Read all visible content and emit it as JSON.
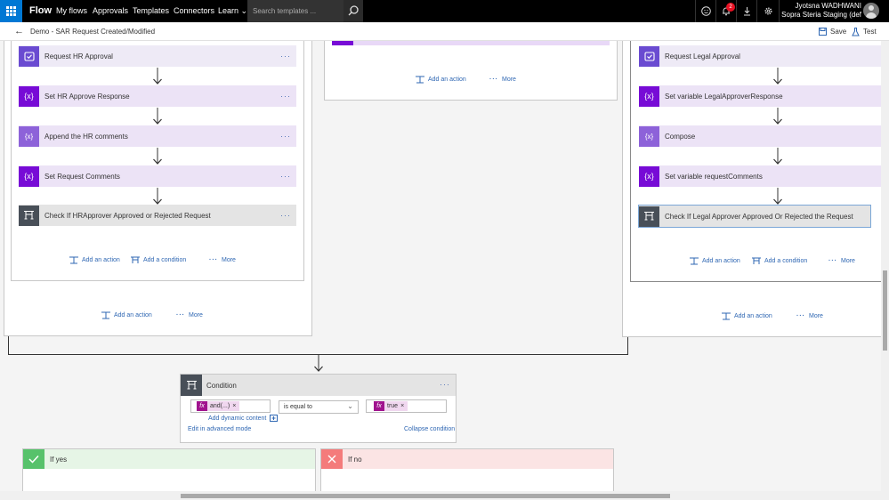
{
  "topbar": {
    "brand": "Flow",
    "nav": [
      "My flows",
      "Approvals",
      "Templates",
      "Connectors",
      "Learn"
    ],
    "search_placeholder": "Search templates ...",
    "notification_count": "2",
    "user_name": "Jyotsna WADHWANI",
    "user_org": "Sopra Steria Staging (def"
  },
  "subbar": {
    "flow_name": "Demo - SAR Request Created/Modified",
    "save_label": "Save",
    "test_label": "Test"
  },
  "left_panel": {
    "steps": [
      {
        "label": "Request HR Approval",
        "icon": "approval-icon"
      },
      {
        "label": "Set HR Approve Response",
        "icon": "variable-icon"
      },
      {
        "label": "Append the HR comments",
        "icon": "variable-icon"
      },
      {
        "label": "Set Request Comments",
        "icon": "variable-icon"
      },
      {
        "label": "Check If HRApprover Approved or Rejected Request",
        "icon": "condition-icon"
      }
    ],
    "inner_add_action": "Add an action",
    "inner_add_condition": "Add a condition",
    "inner_more": "More",
    "outer_add_action": "Add an action",
    "outer_more": "More"
  },
  "middle_panel": {
    "add_action": "Add an action",
    "more": "More"
  },
  "right_panel": {
    "steps": [
      {
        "label": "Request Legal Approval",
        "icon": "approval-icon"
      },
      {
        "label": "Set variable LegalApproverResponse",
        "icon": "variable-icon"
      },
      {
        "label": "Compose",
        "icon": "variable-icon"
      },
      {
        "label": "Set variable requestComments",
        "icon": "variable-icon"
      },
      {
        "label": "Check If Legal Approver Approved Or Rejected the Request",
        "icon": "condition-icon"
      }
    ],
    "inner_add_action": "Add an action",
    "inner_add_condition": "Add a condition",
    "inner_more": "More",
    "outer_add_action": "Add an action",
    "outer_more": "More"
  },
  "condition": {
    "title": "Condition",
    "left_token": "and(...)",
    "operator": "is equal to",
    "right_token": "true",
    "add_dynamic": "Add dynamic content",
    "edit_advanced": "Edit in advanced mode",
    "collapse": "Collapse condition"
  },
  "branches": {
    "yes_label": "If yes",
    "no_label": "If no"
  },
  "colors": {
    "accent_blue": "#0078d4",
    "approval": "#6a4bd1",
    "variable": "#770bd6",
    "condition": "#484f58",
    "yes": "#57c26b",
    "no": "#f47b7b"
  }
}
